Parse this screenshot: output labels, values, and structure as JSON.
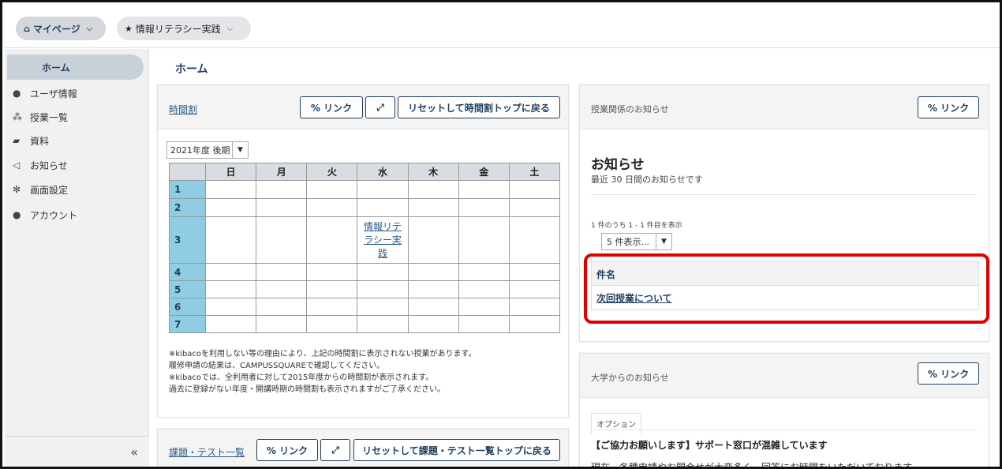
{
  "topbar": {
    "mypage": {
      "icon": "home-icon",
      "label": "マイページ"
    },
    "course": {
      "icon": "star-icon",
      "label": "情報リテラシー実践"
    }
  },
  "sidebar": {
    "home": "ホーム",
    "items": [
      {
        "icon": "user-icon",
        "label": "ユーザ情報"
      },
      {
        "icon": "users-icon",
        "label": "授業一覧"
      },
      {
        "icon": "folder-icon",
        "label": "資料"
      },
      {
        "icon": "megaphone-icon",
        "label": "お知らせ"
      },
      {
        "icon": "gear-icon",
        "label": "画面設定"
      },
      {
        "icon": "user-icon",
        "label": "アカウント"
      }
    ],
    "collapse": "«"
  },
  "main": {
    "title": "ホーム",
    "timetable": {
      "title": "時間割",
      "link_btn": "% リンク",
      "expand_btn": "⤢",
      "reset_btn": "リセットして時間割トップに戻る",
      "term": "2021年度 後期",
      "days": [
        "日",
        "月",
        "火",
        "水",
        "木",
        "金",
        "土"
      ],
      "periods": [
        "1",
        "2",
        "3",
        "4",
        "5",
        "6",
        "7"
      ],
      "course_cell": "情報リテラシー実践",
      "notes": [
        "※kibacoを利用しない等の理由により、上記の時間割に表示されない授業があります。",
        "履修申請の結果は、CAMPUSSQUAREで確認してください。",
        "※kibacoでは、全利用者に対して2015年度からの時間割が表示されます。",
        "過去に登録がない年度・開講時期の時間割も表示されますがご了承ください。"
      ]
    },
    "tasks": {
      "title": "課題・テスト一覧",
      "link_btn": "% リンク",
      "expand_btn": "⤢",
      "reset_btn": "リセットして課題・テスト一覧トップに戻る"
    },
    "class_notices": {
      "label": "授業関係のお知らせ",
      "link_btn": "% リンク",
      "heading": "お知らせ",
      "sub": "最近 30 日間のお知らせです",
      "count": "1 件のうち 1 - 1 件目を表示",
      "per_page": "5 件表示...",
      "column": "件名",
      "items": [
        "次回授業について"
      ]
    },
    "univ_notices": {
      "label": "大学からのお知らせ",
      "link_btn": "% リンク",
      "option_tab": "オプション",
      "item_title": "【ご協力お願いします】サポート窓口が混雑しています",
      "item_body": "現在、各種申請やお問合せが大変多く、回答にお時間をいただいております。"
    }
  },
  "colors": {
    "accent": "#1f3f5e",
    "period_cell": "#8fcde4",
    "highlight": "#e00000"
  }
}
